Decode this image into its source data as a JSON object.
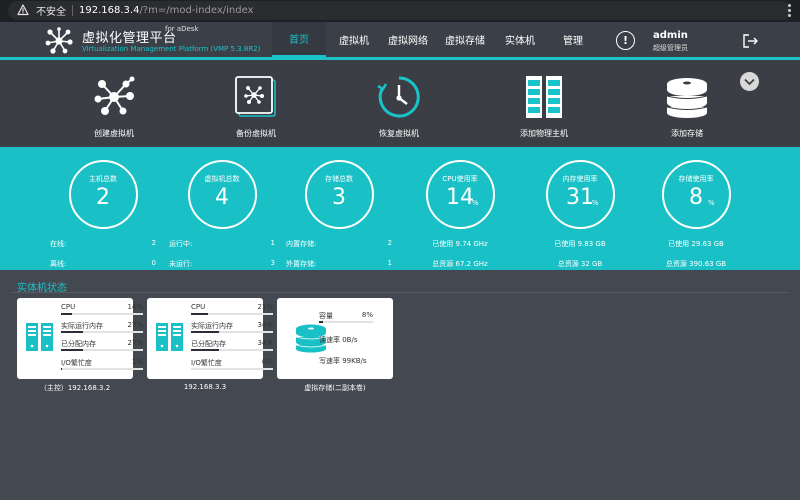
{
  "browser": {
    "insecure_label": "不安全",
    "url_host": "192.168.3.4",
    "url_path": "/?m=/mod-index/index"
  },
  "header": {
    "title": "虚拟化管理平台",
    "for_label": "for aDesk",
    "subtitle": "Virtualization Management Platform (VMP 5.3.8R2)",
    "nav": [
      {
        "label": "首页",
        "active": true
      },
      {
        "label": "虚拟机",
        "active": false
      },
      {
        "label": "虚拟网络",
        "active": false
      },
      {
        "label": "虚拟存储",
        "active": false
      },
      {
        "label": "实体机",
        "active": false
      },
      {
        "label": "管理",
        "active": false
      }
    ],
    "alert_glyph": "!",
    "user_name": "admin",
    "user_role": "超级管理员"
  },
  "actions": [
    {
      "label": "创建虚拟机",
      "icon": "network-nodes-icon"
    },
    {
      "label": "备份虚拟机",
      "icon": "backup-vm-icon"
    },
    {
      "label": "恢复虚拟机",
      "icon": "restore-clock-icon"
    },
    {
      "label": "添加物理主机",
      "icon": "server-rack-icon"
    },
    {
      "label": "添加存储",
      "icon": "disk-stack-icon"
    }
  ],
  "stats": [
    {
      "label": "主机总数",
      "value": "2",
      "unit": "",
      "rows": [
        [
          "在线:",
          "2"
        ],
        [
          "离线:",
          "0"
        ]
      ]
    },
    {
      "label": "虚拟机总数",
      "value": "4",
      "unit": "",
      "rows": [
        [
          "运行中:",
          "1"
        ],
        [
          "未运行:",
          "3"
        ]
      ]
    },
    {
      "label": "存储总数",
      "value": "3",
      "unit": "",
      "rows": [
        [
          "内置存储:",
          "2"
        ],
        [
          "外置存储:",
          "1"
        ]
      ]
    },
    {
      "label": "CPU使用率",
      "value": "14",
      "unit": "%",
      "rows": [
        [
          "已使用 9.74 GHz"
        ],
        [
          "总资源 67.2 GHz"
        ]
      ]
    },
    {
      "label": "内存使用率",
      "value": "31",
      "unit": "%",
      "rows": [
        [
          "已使用 9.83 GB"
        ],
        [
          "总资源 32 GB"
        ]
      ]
    },
    {
      "label": "存储使用率",
      "value": "8",
      "unit": "%",
      "rows": [
        [
          "已使用 29.63 GB"
        ],
        [
          "总资源 390.63 GB"
        ]
      ]
    }
  ],
  "hosts_section": {
    "title": "实体机状态",
    "hosts": [
      {
        "caption": "（主控）192.168.3.2",
        "metrics": [
          {
            "label": "CPU",
            "value": "14%",
            "fill": 0.14
          },
          {
            "label": "实际运行内存",
            "value": "27%",
            "fill": 0.27
          },
          {
            "label": "已分配内存",
            "value": "27%",
            "fill": 0.27
          },
          {
            "label": "I/O繁忙度",
            "value": "1%",
            "fill": 0.01
          }
        ]
      },
      {
        "caption": "192.168.3.3",
        "metrics": [
          {
            "label": "CPU",
            "value": "21%",
            "fill": 0.21
          },
          {
            "label": "实际运行内存",
            "value": "34%",
            "fill": 0.34
          },
          {
            "label": "已分配内存",
            "value": "34%",
            "fill": 0.34
          },
          {
            "label": "I/O繁忙度",
            "value": "0%",
            "fill": 0.0
          }
        ]
      }
    ],
    "storage": {
      "caption": "虚拟存储(二副本卷)",
      "capacity_label": "容量",
      "capacity_value": "8%",
      "capacity_fill": 0.08,
      "read_label": "读速率 0B/s",
      "write_label": "写速率 99KB/s"
    }
  },
  "colors": {
    "accent": "#19c3c9",
    "dark_bg": "#444951",
    "header_bg": "#3b4048"
  }
}
